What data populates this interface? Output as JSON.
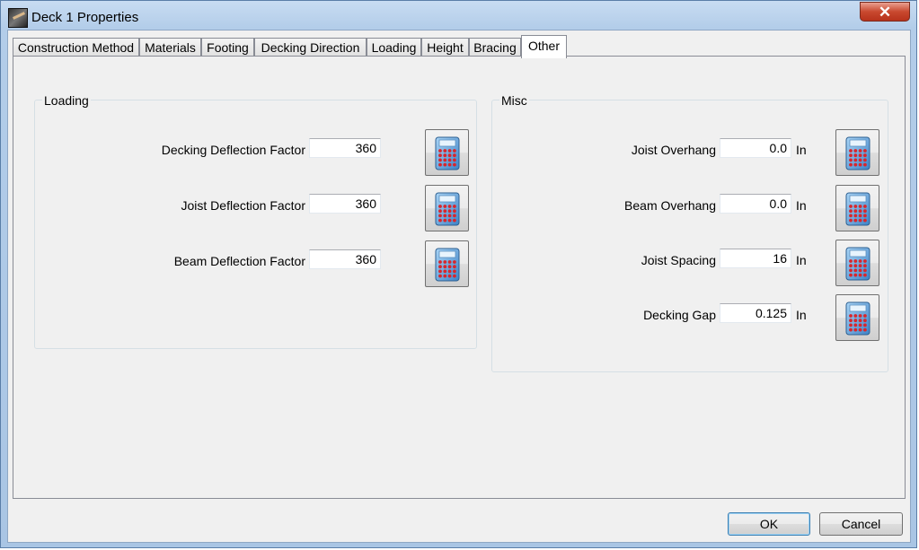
{
  "window": {
    "title": "Deck 1 Properties",
    "close_glyph": "✕"
  },
  "tabs": [
    {
      "label": "Construction Method"
    },
    {
      "label": "Materials"
    },
    {
      "label": "Footing"
    },
    {
      "label": "Decking Direction"
    },
    {
      "label": "Loading"
    },
    {
      "label": "Height"
    },
    {
      "label": "Bracing"
    },
    {
      "label": "Other",
      "active": true
    }
  ],
  "loading": {
    "title": "Loading",
    "rows": [
      {
        "label": "Decking Deflection Factor",
        "value": "360"
      },
      {
        "label": "Joist Deflection Factor",
        "value": "360"
      },
      {
        "label": "Beam Deflection Factor",
        "value": "360"
      }
    ]
  },
  "misc": {
    "title": "Misc",
    "rows": [
      {
        "label": "Joist Overhang",
        "value": "0.0",
        "unit": "In"
      },
      {
        "label": "Beam Overhang",
        "value": "0.0",
        "unit": "In"
      },
      {
        "label": "Joist Spacing",
        "value": "16",
        "unit": "In"
      },
      {
        "label": "Decking Gap",
        "value": "0.125",
        "unit": "In"
      }
    ]
  },
  "buttons": {
    "ok": "OK",
    "cancel": "Cancel"
  },
  "icons": {
    "calculator": "calculator-icon",
    "app": "deck-app-icon",
    "close": "close-icon"
  },
  "colors": {
    "title_bar": "#b3cde9",
    "close_button": "#c9492f",
    "dialog_bg": "#f0f0f0"
  }
}
